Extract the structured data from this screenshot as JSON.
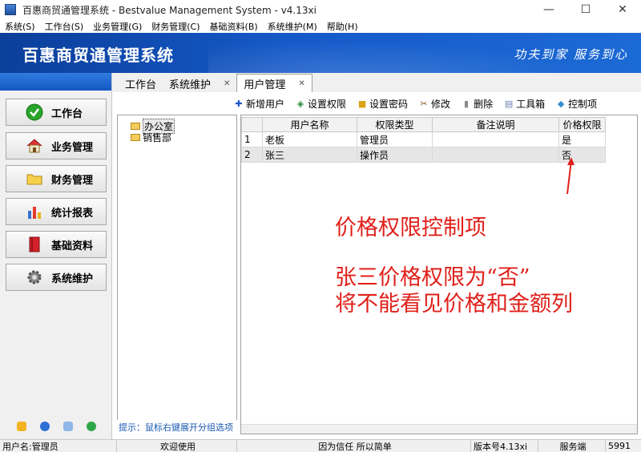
{
  "window": {
    "title": "百惠商贸通管理系统 - Bestvalue Management System - v4.13xi",
    "minimize": "—",
    "maximize": "☐",
    "close": "✕"
  },
  "menu": [
    "系统(S)",
    "工作台(S)",
    "业务管理(G)",
    "财务管理(C)",
    "基础资料(B)",
    "系统维护(M)",
    "帮助(H)"
  ],
  "banner": {
    "title": "百惠商贸通管理系统",
    "slogan": "功夫到家 服务到心"
  },
  "nav": [
    {
      "label": "工作台",
      "icon": "check-icon"
    },
    {
      "label": "业务管理",
      "icon": "house-icon"
    },
    {
      "label": "财务管理",
      "icon": "folder-icon"
    },
    {
      "label": "统计报表",
      "icon": "bar-chart-icon"
    },
    {
      "label": "基础资料",
      "icon": "book-icon"
    },
    {
      "label": "系统维护",
      "icon": "gear-icon"
    }
  ],
  "tabs": [
    {
      "label": "工作台",
      "closable": false
    },
    {
      "label": "系统维护",
      "closable": true
    },
    {
      "label": "用户管理",
      "closable": true,
      "active": true
    }
  ],
  "toolbar": [
    "新增用户",
    "设置权限",
    "设置密码",
    "修改",
    "删除",
    "工具箱",
    "控制项"
  ],
  "tree": [
    "办公室",
    "销售部"
  ],
  "hint": "提示：鼠标右键展开分组选项",
  "grid": {
    "columns": [
      "",
      "用户名称",
      "权限类型",
      "备注说明",
      "价格权限"
    ],
    "rows": [
      [
        "1",
        "老板",
        "管理员",
        "",
        "是"
      ],
      [
        "2",
        "张三",
        "操作员",
        "",
        "否"
      ]
    ]
  },
  "annotation": {
    "line1": "价格权限控制项",
    "line2": "张三价格权限为“否”",
    "line3": "将不能看见价格和金额列",
    "color": "#e0201a"
  },
  "status": {
    "user": "用户名:管理员",
    "welcome": "欢迎使用",
    "motto": "因为信任 所以简单",
    "version": "版本号4.13xi",
    "mode": "服务端",
    "extra": "5991"
  }
}
